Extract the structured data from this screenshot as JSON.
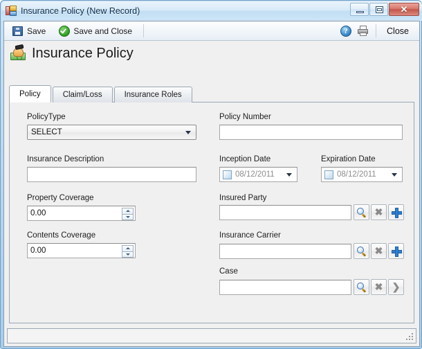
{
  "window": {
    "title": "Insurance Policy (New Record)",
    "title_icon": "form-icon",
    "minimize_label": "Minimize",
    "maximize_label": "Maximize",
    "close_label": "Close"
  },
  "toolbar": {
    "save_label": "Save",
    "save_and_close_label": "Save and Close",
    "help_icon": "help-icon",
    "print_icon": "printer-icon",
    "close_label": "Close"
  },
  "header": {
    "icon": "money-in-hand-icon",
    "title": "Insurance Policy"
  },
  "tabs": [
    {
      "label": "Policy",
      "active": true
    },
    {
      "label": "Claim/Loss",
      "active": false
    },
    {
      "label": "Insurance Roles",
      "active": false
    }
  ],
  "form": {
    "policy_type": {
      "label": "PolicyType",
      "value": "SELECT"
    },
    "insurance_description": {
      "label": "Insurance Description",
      "value": "",
      "placeholder": ""
    },
    "property_coverage": {
      "label": "Property Coverage",
      "value": "0.00"
    },
    "contents_coverage": {
      "label": "Contents Coverage",
      "value": "0.00"
    },
    "policy_number": {
      "label": "Policy Number",
      "value": "",
      "placeholder": ""
    },
    "inception_date": {
      "label": "Inception Date",
      "value": "08/12/2011",
      "checked": false
    },
    "expiration_date": {
      "label": "Expiration Date",
      "value": "08/12/2011",
      "checked": false
    },
    "insured_party": {
      "label": "Insured Party",
      "value": "",
      "search_icon": "magnifier-icon",
      "clear_icon": "x-icon",
      "add_icon": "plus-icon"
    },
    "insurance_carrier": {
      "label": "Insurance Carrier",
      "value": "",
      "search_icon": "magnifier-icon",
      "clear_icon": "x-icon",
      "add_icon": "plus-icon"
    },
    "case": {
      "label": "Case",
      "value": "",
      "search_icon": "magnifier-icon",
      "clear_icon": "x-icon",
      "go_icon": "chevron-right-icon"
    }
  },
  "statusbar": {
    "text": "",
    "grip": "resize-grip"
  },
  "colors": {
    "frame": "#a8cdec",
    "panel_bg": "#f0f0f0",
    "accent_blue": "#2f7fd0",
    "close_red": "#c4564a",
    "green_check": "#35a32a"
  }
}
